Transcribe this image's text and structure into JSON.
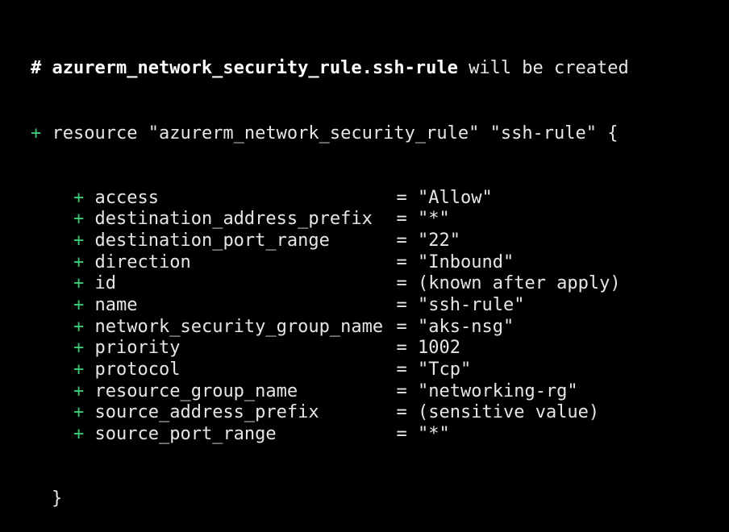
{
  "terminal": {
    "header": {
      "hash": "#",
      "resource_address": "azurerm_network_security_rule.ssh-rule",
      "status_text": "will be created"
    },
    "resource_line": {
      "plus": "+",
      "keyword": "resource",
      "type": "\"azurerm_network_security_rule\"",
      "name": "\"ssh-rule\"",
      "open_brace": "{"
    },
    "attributes": [
      {
        "plus": "+",
        "name": "access",
        "eq": "=",
        "value": "\"Allow\""
      },
      {
        "plus": "+",
        "name": "destination_address_prefix",
        "eq": "=",
        "value": "\"*\""
      },
      {
        "plus": "+",
        "name": "destination_port_range",
        "eq": "=",
        "value": "\"22\""
      },
      {
        "plus": "+",
        "name": "direction",
        "eq": "=",
        "value": "\"Inbound\""
      },
      {
        "plus": "+",
        "name": "id",
        "eq": "=",
        "value": "(known after apply)"
      },
      {
        "plus": "+",
        "name": "name",
        "eq": "=",
        "value": "\"ssh-rule\""
      },
      {
        "plus": "+",
        "name": "network_security_group_name",
        "eq": "=",
        "value": "\"aks-nsg\""
      },
      {
        "plus": "+",
        "name": "priority",
        "eq": "=",
        "value": "1002"
      },
      {
        "plus": "+",
        "name": "protocol",
        "eq": "=",
        "value": "\"Tcp\""
      },
      {
        "plus": "+",
        "name": "resource_group_name",
        "eq": "=",
        "value": "\"networking-rg\""
      },
      {
        "plus": "+",
        "name": "source_address_prefix",
        "eq": "=",
        "value": "(sensitive value)"
      },
      {
        "plus": "+",
        "name": "source_port_range",
        "eq": "=",
        "value": "\"*\""
      }
    ],
    "close_brace": "}",
    "colors": {
      "background": "#000000",
      "text": "#e6e6e6",
      "plus": "#3ec97a",
      "bold": "#ffffff"
    }
  }
}
